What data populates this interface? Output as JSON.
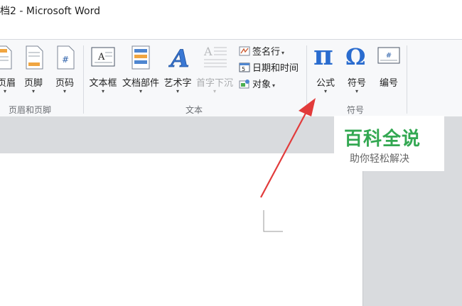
{
  "window": {
    "title": "档2 - Microsoft Word"
  },
  "ribbon": {
    "groups": {
      "header_footer": {
        "label": "页眉和页脚",
        "buttons": {
          "header": "页眉",
          "footer": "页脚",
          "page_number": "页码"
        }
      },
      "text": {
        "label": "文本",
        "buttons": {
          "textbox": "文本框",
          "quick_parts": "文档部件",
          "wordart": "艺术字",
          "drop_cap": "首字下沉"
        },
        "small_items": {
          "signature_line": "签名行",
          "date_time": "日期和时间",
          "object": "对象"
        }
      },
      "symbols": {
        "label": "符号",
        "buttons": {
          "equation": "公式",
          "symbol": "符号",
          "number": "编号"
        }
      }
    }
  },
  "watermark": {
    "title": "百科全说",
    "subtitle": "助你轻松解决"
  },
  "colors": {
    "arrow": "#e23b3b",
    "watermark_green": "#33a852",
    "pi_blue": "#2a6ccf"
  }
}
